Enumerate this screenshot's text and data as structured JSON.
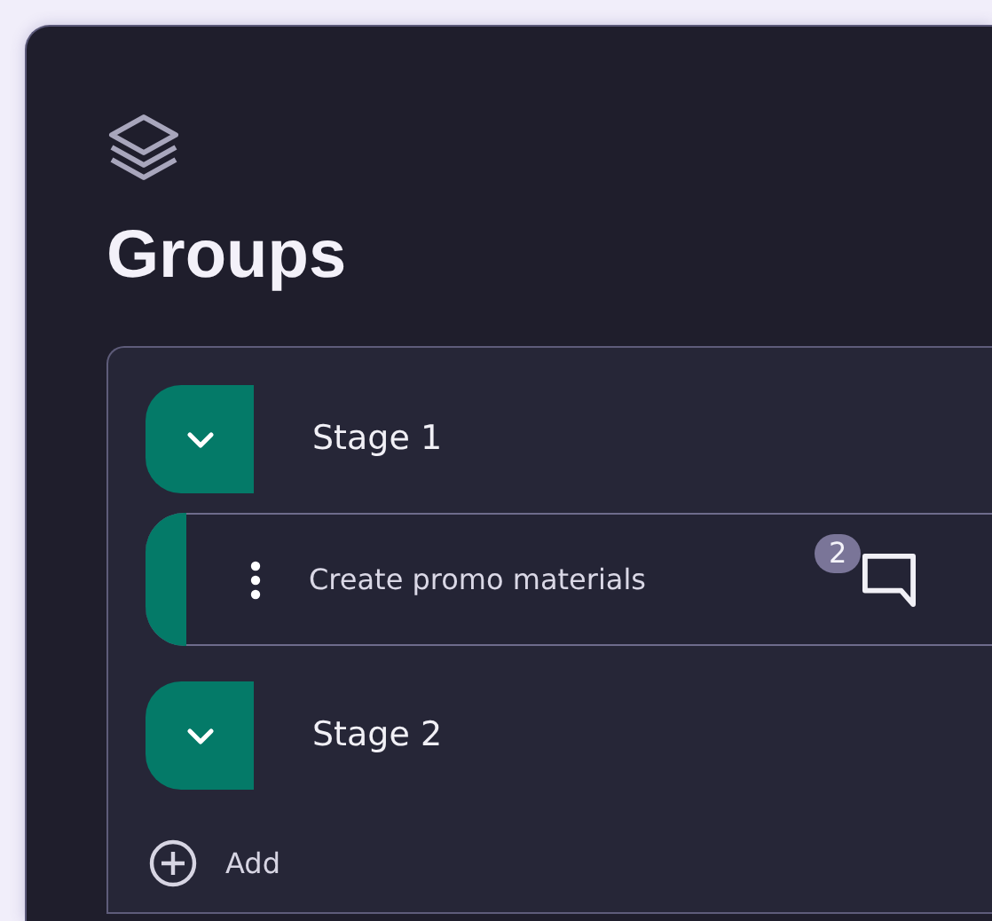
{
  "panel": {
    "title": "Groups"
  },
  "stages": [
    {
      "title": "Stage 1",
      "tasks": [
        {
          "title": "Create promo materials",
          "comment_count": "2"
        }
      ]
    },
    {
      "title": "Stage 2"
    }
  ],
  "add_label": "Add"
}
